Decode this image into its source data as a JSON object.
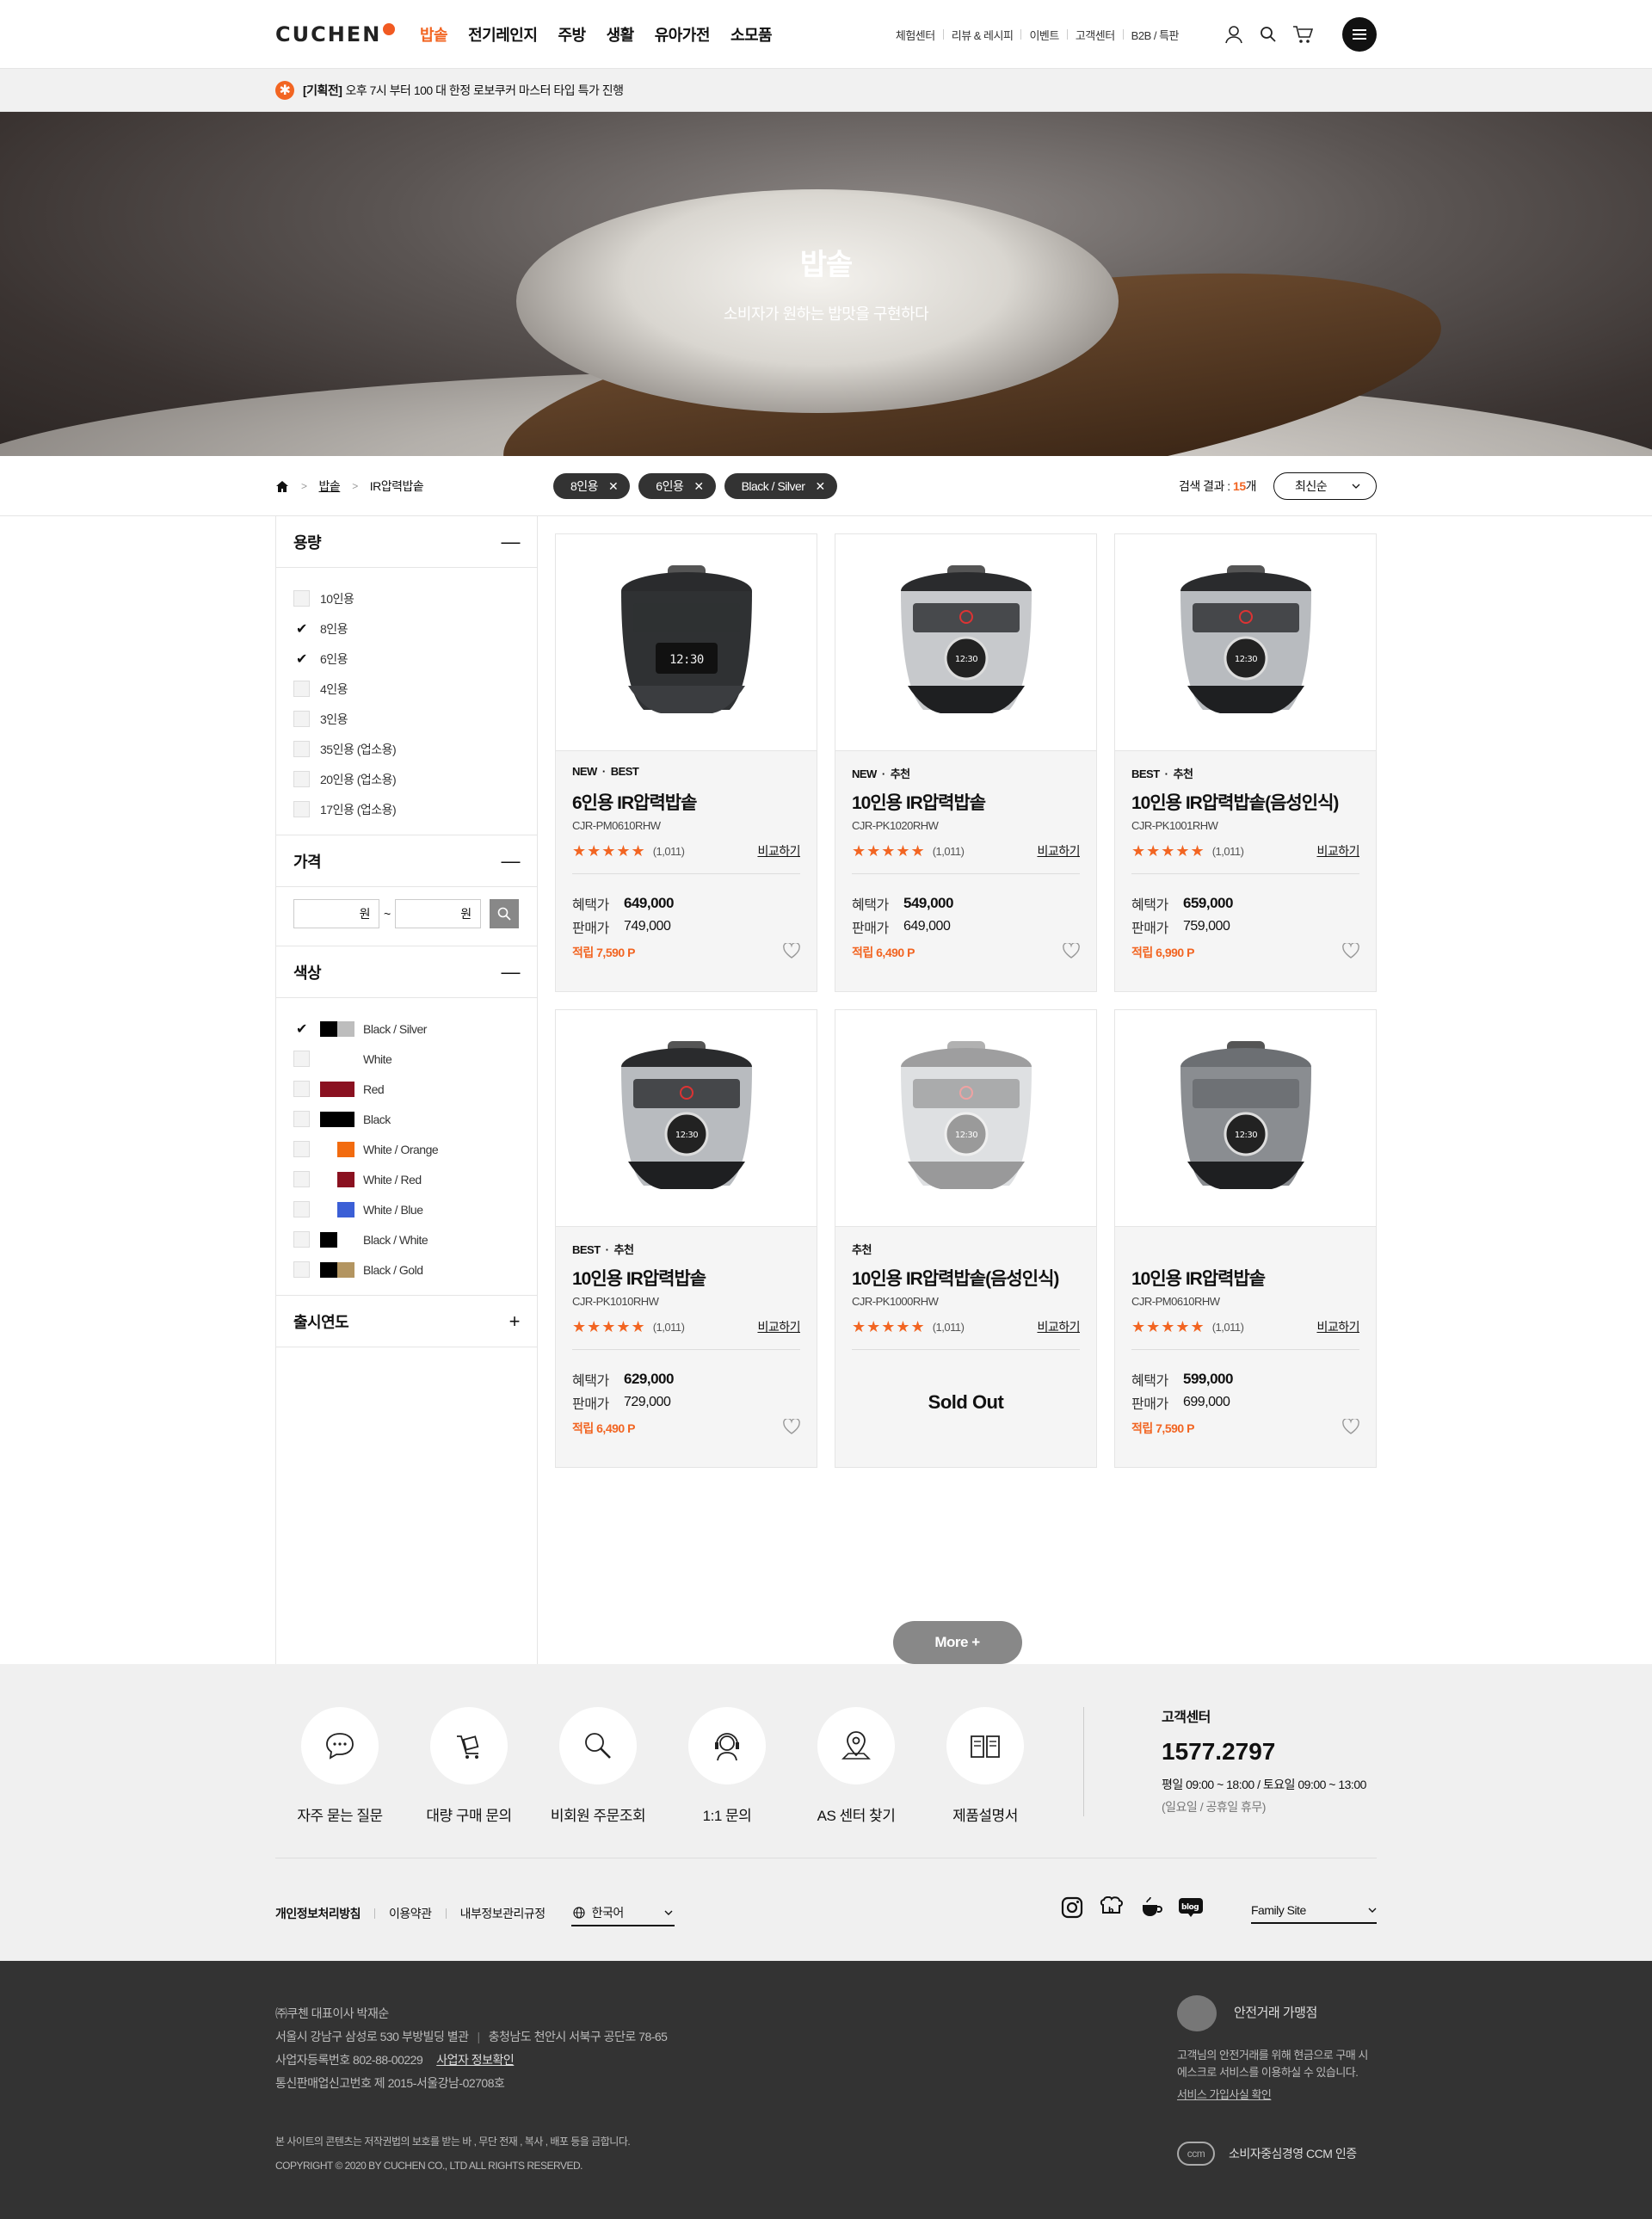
{
  "header": {
    "logo": "CUCHEN",
    "nav": [
      "밥솥",
      "전기레인지",
      "주방",
      "생활",
      "유아가전",
      "소모품"
    ],
    "util": [
      "체험센터",
      "리뷰 & 레시피",
      "이벤트",
      "고객센터",
      "B2B / 특판"
    ]
  },
  "notice": {
    "tag": "[기획전]",
    "text": "오후 7시 부터 100 대 한정 로보쿠커 마스터 타입 특가 진행"
  },
  "hero": {
    "title": "밥솥",
    "subtitle": "소비자가 원하는 밥맛을 구현하다"
  },
  "breadcrumb": {
    "level1": "밥솥",
    "level2": "IR압력밥솥"
  },
  "chips": [
    "8인용",
    "6인용",
    "Black / Silver"
  ],
  "result": {
    "label": "검색 결과 :",
    "count": "15",
    "unit": "개"
  },
  "sort": {
    "value": "최신순"
  },
  "filters": {
    "capacity": {
      "title": "용량",
      "options": [
        {
          "label": "10인용",
          "checked": false
        },
        {
          "label": "8인용",
          "checked": true
        },
        {
          "label": "6인용",
          "checked": true
        },
        {
          "label": "4인용",
          "checked": false
        },
        {
          "label": "3인용",
          "checked": false
        },
        {
          "label": "35인용 (업소용)",
          "checked": false
        },
        {
          "label": "20인용 (업소용)",
          "checked": false
        },
        {
          "label": "17인용 (업소용)",
          "checked": false
        }
      ]
    },
    "price": {
      "title": "가격",
      "unit": "원",
      "tilde": "~"
    },
    "color": {
      "title": "색상",
      "options": [
        {
          "label": "Black / Silver",
          "checked": true,
          "c1": "#000000",
          "c2": "#bdbdbd"
        },
        {
          "label": "White",
          "checked": false,
          "c1": "#ffffff",
          "c2": "#ffffff"
        },
        {
          "label": "Red",
          "checked": false,
          "c1": "#8a1120",
          "c2": "#8a1120"
        },
        {
          "label": "Black",
          "checked": false,
          "c1": "#000000",
          "c2": "#000000"
        },
        {
          "label": "White / Orange",
          "checked": false,
          "c1": "#ffffff",
          "c2": "#f26b0f"
        },
        {
          "label": "White / Red",
          "checked": false,
          "c1": "#ffffff",
          "c2": "#8a1120"
        },
        {
          "label": "White / Blue",
          "checked": false,
          "c1": "#ffffff",
          "c2": "#3b5fd6"
        },
        {
          "label": "Black / White",
          "checked": false,
          "c1": "#000000",
          "c2": "#ffffff"
        },
        {
          "label": "Black / Gold",
          "checked": false,
          "c1": "#000000",
          "c2": "#b39561"
        }
      ]
    },
    "year": {
      "title": "출시연도"
    }
  },
  "products": [
    {
      "tags": [
        "NEW",
        "BEST"
      ],
      "name": "6인용 IR압력밥솥",
      "model": "CJR-PM0610RHW",
      "reviews": "(1,011)",
      "compare": "비교하기",
      "benefit_label": "혜택가",
      "benefit": "649,000",
      "sale_label": "판매가",
      "sale": "749,000",
      "points": "적립 7,590 P",
      "sold_out": false,
      "style": "dark"
    },
    {
      "tags": [
        "NEW",
        "추천"
      ],
      "name": "10인용 IR압력밥솥",
      "model": "CJR-PK1020RHW",
      "reviews": "(1,011)",
      "compare": "비교하기",
      "benefit_label": "혜택가",
      "benefit": "549,000",
      "sale_label": "판매가",
      "sale": "649,000",
      "points": "적립 6,490 P",
      "sold_out": false,
      "style": "silver"
    },
    {
      "tags": [
        "BEST",
        "추천"
      ],
      "name": "10인용 IR압력밥솥(음성인식)",
      "model": "CJR-PK1001RHW",
      "reviews": "(1,011)",
      "compare": "비교하기",
      "benefit_label": "혜택가",
      "benefit": "659,000",
      "sale_label": "판매가",
      "sale": "759,000",
      "points": "적립 6,990 P",
      "sold_out": false,
      "style": "mixed"
    },
    {
      "tags": [
        "BEST",
        "추천"
      ],
      "name": "10인용 IR압력밥솥",
      "model": "CJR-PK1010RHW",
      "reviews": "(1,011)",
      "compare": "비교하기",
      "benefit_label": "혜택가",
      "benefit": "629,000",
      "sale_label": "판매가",
      "sale": "729,000",
      "points": "적립 6,490 P",
      "sold_out": false,
      "style": "mixed"
    },
    {
      "tags": [
        "추천"
      ],
      "name": "10인용 IR압력밥솥(음성인식)",
      "model": "CJR-PK1000RHW",
      "reviews": "(1,011)",
      "compare": "비교하기",
      "sold_out": true,
      "sold_out_label": "Sold Out",
      "style": "mixed"
    },
    {
      "tags": [],
      "name": "10인용 IR압력밥솥",
      "model": "CJR-PM0610RHW",
      "reviews": "(1,011)",
      "compare": "비교하기",
      "benefit_label": "혜택가",
      "benefit": "599,000",
      "sale_label": "판매가",
      "sale": "699,000",
      "points": "적립 7,590 P",
      "sold_out": false,
      "style": "round"
    }
  ],
  "more": "More +",
  "footer": {
    "services": [
      {
        "label": "자주 묻는 질문",
        "icon": "chat-icon"
      },
      {
        "label": "대량 구매 문의",
        "icon": "cart-box-icon"
      },
      {
        "label": "비회원 주문조회",
        "icon": "search-icon"
      },
      {
        "label": "1:1 문의",
        "icon": "headset-icon"
      },
      {
        "label": "AS 센터 찾기",
        "icon": "map-pin-icon"
      },
      {
        "label": "제품설명서",
        "icon": "book-icon"
      }
    ],
    "cs": {
      "title": "고객센터",
      "phone": "1577.2797",
      "hours": "평일 09:00 ~ 18:00 / 토요일 09:00 ~ 13:00",
      "closed": "(일요일 / 공휴일 휴무)"
    },
    "links": [
      "개인정보처리방침",
      "이용약관",
      "내부정보관리규정"
    ],
    "lang": "한국어",
    "family": "Family Site",
    "address": [
      "㈜쿠첸 대표이사 박재순",
      "서울시 강남구 삼성로 530 부방빌딩 별관",
      "충청남도 천안시 서북구 공단로 78-65",
      "사업자등록번호 802-88-00229",
      "사업자 정보확인",
      "통신판매업신고번호 제 2015-서울강남-02708호"
    ],
    "copy1": "본 사이트의 콘텐츠는 저작권법의 보호를 받는 바 , 무단 전재 , 복사 , 배포 등을 금합니다.",
    "copy2": "COPYRIGHT © 2020 BY CUCHEN CO., LTD ALL RIGHTS RESERVED.",
    "escrow": {
      "title": "안전거래 가맹점",
      "desc1": "고객님의 안전거래를 위해 현금으로 구매 시",
      "desc2": "에스크로 서비스를 이용하실 수 있습니다.",
      "link": "서비스 가입사실 확인"
    },
    "ccm": {
      "label": "소비자중심경영 CCM 인증",
      "mark": "ccm"
    }
  }
}
